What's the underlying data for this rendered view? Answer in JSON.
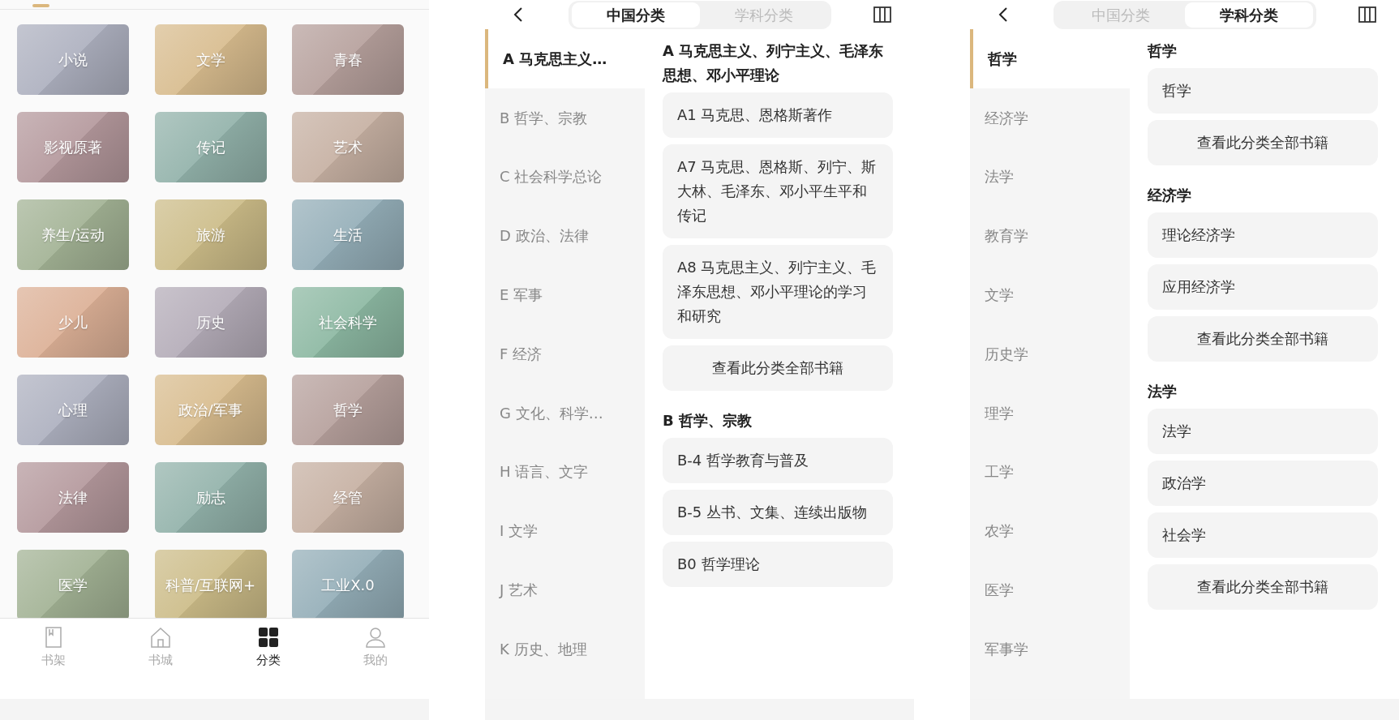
{
  "category_screen": {
    "categories": [
      {
        "label": "小说",
        "color": "#adb0bf"
      },
      {
        "label": "文学",
        "color": "#d8bc8e"
      },
      {
        "label": "青春",
        "color": "#b6a09c"
      },
      {
        "label": "影视原著",
        "color": "#b4989c"
      },
      {
        "label": "传记",
        "color": "#92b2aa"
      },
      {
        "label": "艺术",
        "color": "#c6b0a2"
      },
      {
        "label": "养生/运动",
        "color": "#a2b294"
      },
      {
        "label": "旅游",
        "color": "#ccbc88"
      },
      {
        "label": "生活",
        "color": "#94aeb8"
      },
      {
        "label": "少儿",
        "color": "#dcb096"
      },
      {
        "label": "历史",
        "color": "#b4acb8"
      },
      {
        "label": "社会科学",
        "color": "#8cb8a2"
      },
      {
        "label": "心理",
        "color": "#adb0bf"
      },
      {
        "label": "政治/军事",
        "color": "#d8bc8e"
      },
      {
        "label": "哲学",
        "color": "#b6a09c"
      },
      {
        "label": "法律",
        "color": "#b4989c"
      },
      {
        "label": "励志",
        "color": "#92b2aa"
      },
      {
        "label": "经管",
        "color": "#c6b0a2"
      },
      {
        "label": "医学",
        "color": "#a2b294"
      },
      {
        "label": "科普/互联网+",
        "color": "#ccbc88"
      },
      {
        "label": "工业X.0",
        "color": "#94aeb8"
      }
    ],
    "bottom_nav": [
      {
        "label": "书架",
        "kind": "bookshelf",
        "selected": false
      },
      {
        "label": "书城",
        "kind": "store",
        "selected": false
      },
      {
        "label": "分类",
        "kind": "category",
        "selected": true
      },
      {
        "label": "我的",
        "kind": "profile",
        "selected": false
      }
    ]
  },
  "screens": [
    {
      "tabs": [
        {
          "label": "中国分类",
          "selected": true
        },
        {
          "label": "学科分类",
          "selected": false
        }
      ],
      "sidebar": [
        {
          "label": "A 马克思主义…",
          "selected": true
        },
        {
          "label": "B 哲学、宗教",
          "selected": false
        },
        {
          "label": "C 社会科学总论",
          "selected": false
        },
        {
          "label": "D 政治、法律",
          "selected": false
        },
        {
          "label": "E 军事",
          "selected": false
        },
        {
          "label": "F 经济",
          "selected": false
        },
        {
          "label": "G 文化、科学…",
          "selected": false
        },
        {
          "label": "H 语言、文字",
          "selected": false
        },
        {
          "label": "I 文学",
          "selected": false
        },
        {
          "label": "J 艺术",
          "selected": false
        },
        {
          "label": "K 历史、地理",
          "selected": false
        }
      ],
      "sections": [
        {
          "heading": "A 马克思主义、列宁主义、毛泽东思想、邓小平理论",
          "items": [
            {
              "label": "A1 马克思、恩格斯著作",
              "kind": "subcategory"
            },
            {
              "label": "A7 马克思、恩格斯、列宁、斯大林、毛泽东、邓小平生平和传记",
              "kind": "subcategory"
            },
            {
              "label": "A8 马克思主义、列宁主义、毛泽东思想、邓小平理论的学习和研究",
              "kind": "subcategory"
            },
            {
              "label": "查看此分类全部书籍",
              "kind": "view_all"
            }
          ]
        },
        {
          "heading": "B 哲学、宗教",
          "items": [
            {
              "label": "B-4 哲学教育与普及",
              "kind": "subcategory"
            },
            {
              "label": "B-5 丛书、文集、连续出版物",
              "kind": "subcategory"
            },
            {
              "label": "B0 哲学理论",
              "kind": "subcategory"
            }
          ]
        }
      ]
    },
    {
      "tabs": [
        {
          "label": "中国分类",
          "selected": false
        },
        {
          "label": "学科分类",
          "selected": true
        }
      ],
      "sidebar": [
        {
          "label": "哲学",
          "selected": true
        },
        {
          "label": "经济学",
          "selected": false
        },
        {
          "label": "法学",
          "selected": false
        },
        {
          "label": "教育学",
          "selected": false
        },
        {
          "label": "文学",
          "selected": false
        },
        {
          "label": "历史学",
          "selected": false
        },
        {
          "label": "理学",
          "selected": false
        },
        {
          "label": "工学",
          "selected": false
        },
        {
          "label": "农学",
          "selected": false
        },
        {
          "label": "医学",
          "selected": false
        },
        {
          "label": "军事学",
          "selected": false
        }
      ],
      "sections": [
        {
          "heading": "哲学",
          "items": [
            {
              "label": "哲学",
              "kind": "subcategory"
            },
            {
              "label": "查看此分类全部书籍",
              "kind": "view_all"
            }
          ]
        },
        {
          "heading": "经济学",
          "items": [
            {
              "label": "理论经济学",
              "kind": "subcategory"
            },
            {
              "label": "应用经济学",
              "kind": "subcategory"
            },
            {
              "label": "查看此分类全部书籍",
              "kind": "view_all"
            }
          ]
        },
        {
          "heading": "法学",
          "items": [
            {
              "label": "法学",
              "kind": "subcategory"
            },
            {
              "label": "政治学",
              "kind": "subcategory"
            },
            {
              "label": "社会学",
              "kind": "subcategory"
            },
            {
              "label": "查看此分类全部书籍",
              "kind": "view_all"
            }
          ]
        }
      ]
    }
  ]
}
